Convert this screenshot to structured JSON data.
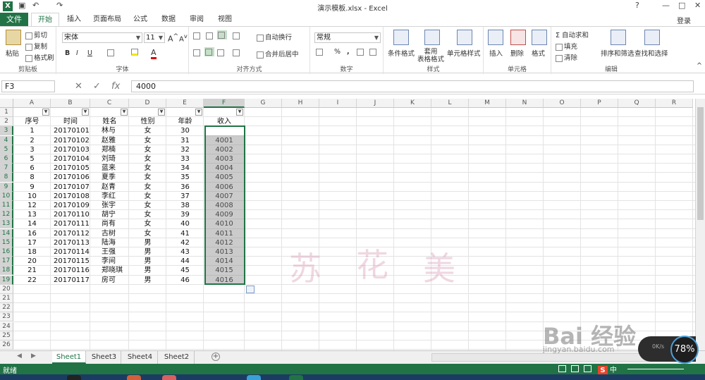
{
  "title_bar": {
    "window_title": "演示模板.xlsx - Excel",
    "help": "?",
    "minimize": "—",
    "restore": "□",
    "close": "✕",
    "undo_icon": "↶",
    "redo_icon": "↷"
  },
  "tabs": {
    "file": "文件",
    "items": [
      "开始",
      "插入",
      "页面布局",
      "公式",
      "数据",
      "审阅",
      "视图"
    ],
    "active_index": 0,
    "login": "登录"
  },
  "ribbon": {
    "clipboard": {
      "label": "剪贴板",
      "paste": "粘贴",
      "cut": "剪切",
      "copy": "复制",
      "format_painter": "格式刷"
    },
    "font": {
      "label": "字体",
      "name": "宋体",
      "size": "11",
      "bold": "B",
      "italic": "I",
      "underline": "U"
    },
    "alignment": {
      "label": "对齐方式",
      "wrap": "自动换行",
      "merge": "合并后居中"
    },
    "number": {
      "label": "数字",
      "format": "常规",
      "percent": "%",
      "comma": ","
    },
    "styles": {
      "label": "样式",
      "conditional": "条件格式",
      "table_format": "套用\n表格格式",
      "cell_style": "单元格样式"
    },
    "cells": {
      "label": "单元格",
      "insert": "插入",
      "delete": "删除",
      "format": "格式"
    },
    "editing": {
      "label": "编辑",
      "autosum": "自动求和",
      "fill": "填充",
      "clear": "清除",
      "sort_filter": "排序和筛选",
      "find_select": "查找和选择"
    }
  },
  "formula_bar": {
    "name_box": "F3",
    "cancel": "✕",
    "enter": "✓",
    "fx": "fx",
    "value": "4000"
  },
  "grid": {
    "columns": [
      "A",
      "B",
      "C",
      "D",
      "E",
      "F",
      "G",
      "H",
      "I",
      "J",
      "K",
      "L",
      "M",
      "N",
      "O",
      "P",
      "Q",
      "R"
    ],
    "row_numbers": [
      "1",
      "2",
      "3",
      "4",
      "5",
      "6",
      "7",
      "8",
      "9",
      "10",
      "11",
      "12",
      "13",
      "14",
      "15",
      "16",
      "17",
      "18",
      "19",
      "20",
      "21",
      "22",
      "23",
      "24",
      "25",
      "26"
    ],
    "headers": [
      "序号",
      "时间",
      "姓名",
      "性别",
      "年龄",
      "收入"
    ],
    "rows": [
      [
        "1",
        "20170101",
        "林与",
        "女",
        "30",
        "4000"
      ],
      [
        "2",
        "20170102",
        "赵雅",
        "女",
        "31",
        "4001"
      ],
      [
        "3",
        "20170103",
        "郑楠",
        "女",
        "32",
        "4002"
      ],
      [
        "5",
        "20170104",
        "刘琦",
        "女",
        "33",
        "4003"
      ],
      [
        "6",
        "20170105",
        "蓝来",
        "女",
        "34",
        "4004"
      ],
      [
        "8",
        "20170106",
        "夏季",
        "女",
        "35",
        "4005"
      ],
      [
        "9",
        "20170107",
        "赵青",
        "女",
        "36",
        "4006"
      ],
      [
        "10",
        "20170108",
        "李红",
        "女",
        "37",
        "4007"
      ],
      [
        "12",
        "20170109",
        "张宇",
        "女",
        "38",
        "4008"
      ],
      [
        "13",
        "20170110",
        "胡宁",
        "女",
        "39",
        "4009"
      ],
      [
        "14",
        "20170111",
        "尚有",
        "女",
        "40",
        "4010"
      ],
      [
        "16",
        "20170112",
        "古树",
        "女",
        "41",
        "4011"
      ],
      [
        "17",
        "20170113",
        "陆海",
        "男",
        "42",
        "4012"
      ],
      [
        "18",
        "20170114",
        "王强",
        "男",
        "43",
        "4013"
      ],
      [
        "20",
        "20170115",
        "李间",
        "男",
        "44",
        "4014"
      ],
      [
        "21",
        "20170116",
        "郑晓琪",
        "男",
        "45",
        "4015"
      ],
      [
        "22",
        "20170117",
        "房可",
        "男",
        "46",
        "4016"
      ]
    ],
    "filter_glyph": "▼",
    "watermark": [
      "苏",
      "花",
      "美"
    ]
  },
  "sheets": {
    "tabs": [
      "Sheet1",
      "Sheet3",
      "Sheet4",
      "Sheet2"
    ],
    "active_index": 0,
    "add": "+"
  },
  "status_bar": {
    "status": "就绪",
    "ime_label": "中"
  },
  "overlays": {
    "speed_percent": "78%",
    "speed_rate": "0K/s",
    "baidu_logo": "Bai  经验",
    "baidu_url": "jingyan.baidu.com"
  }
}
